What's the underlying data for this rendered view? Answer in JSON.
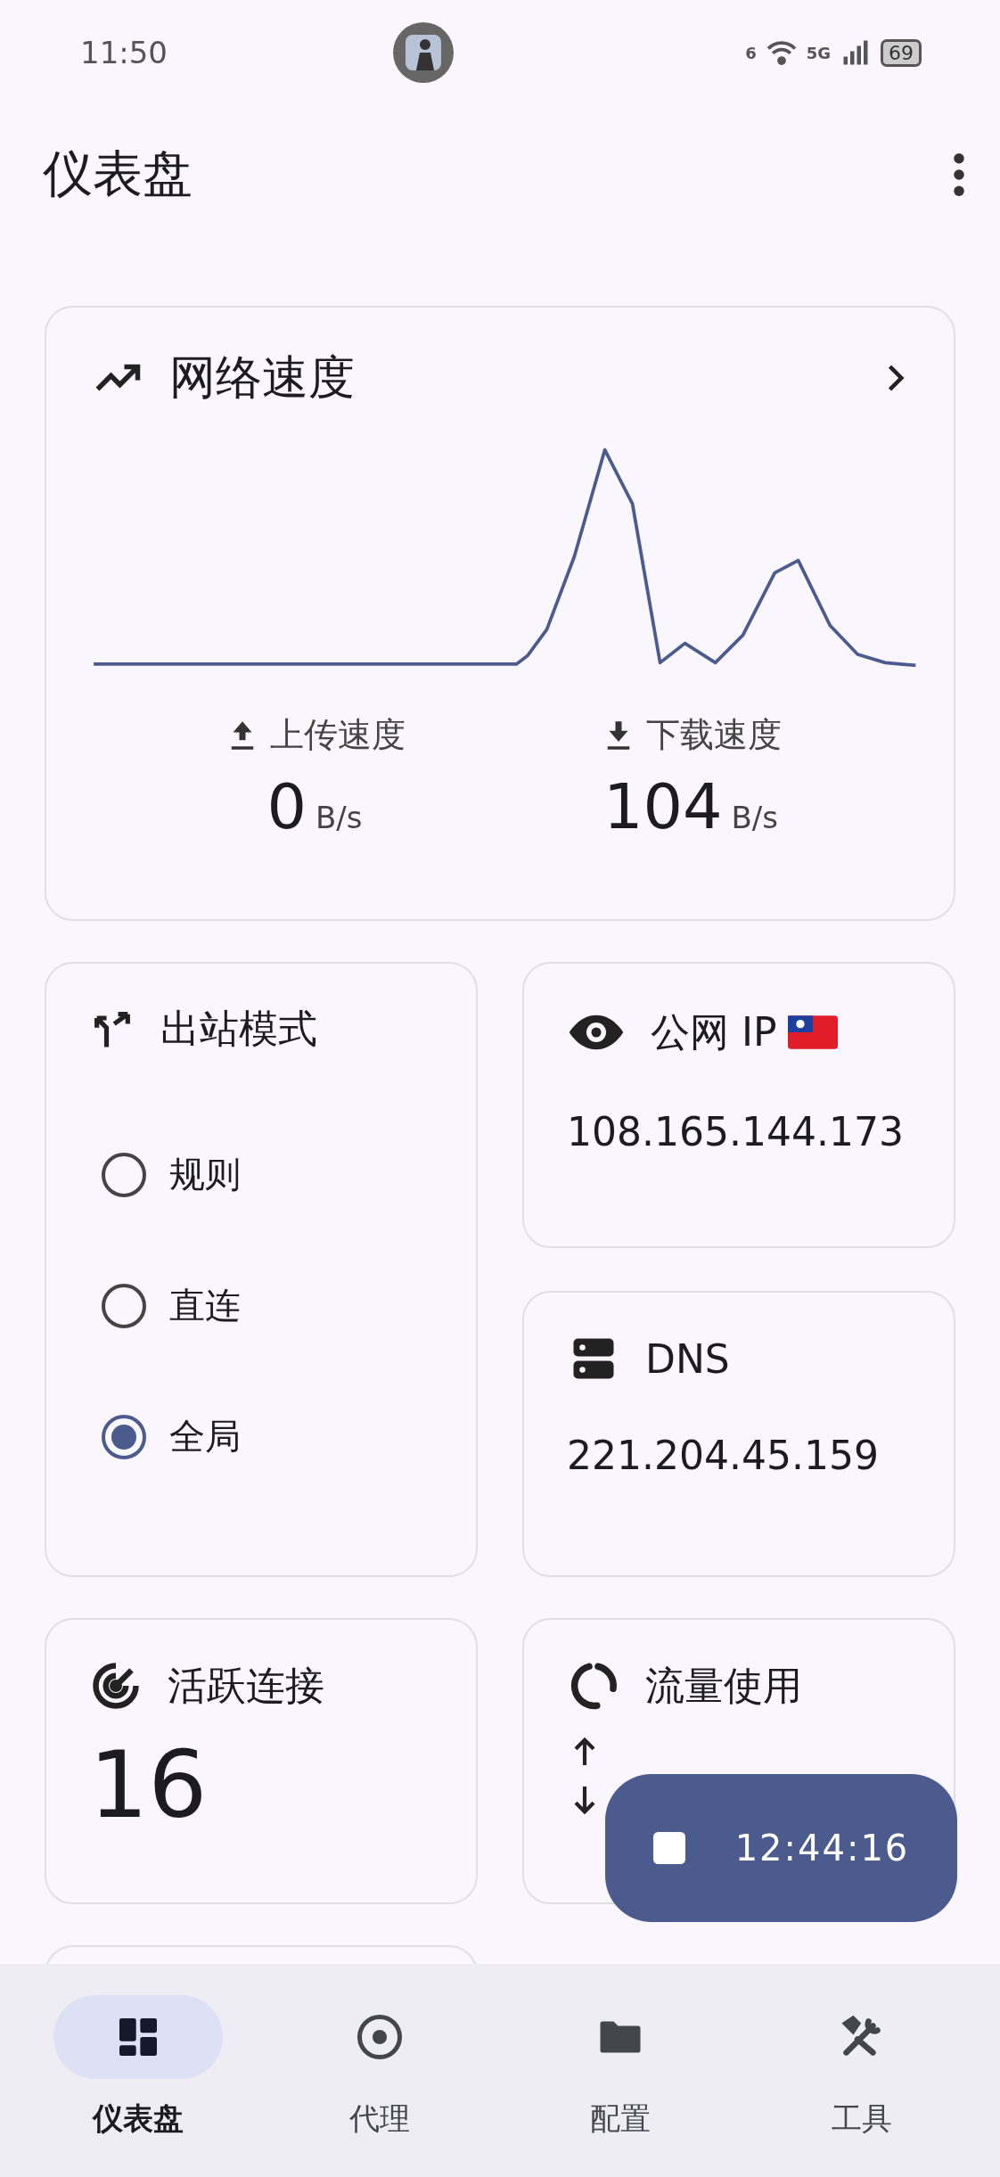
{
  "status_bar": {
    "time": "11:50",
    "wifi_label": "6",
    "network_label": "5G",
    "battery": "69"
  },
  "app_bar": {
    "title": "仪表盘"
  },
  "speed_card": {
    "title": "网络速度",
    "upload": {
      "label": "上传速度",
      "value": "0",
      "unit": "B/s"
    },
    "download": {
      "label": "下载速度",
      "value": "104",
      "unit": "B/s"
    }
  },
  "outbound_card": {
    "title": "出站模式",
    "options": [
      {
        "label": "规则",
        "selected": false
      },
      {
        "label": "直连",
        "selected": false
      },
      {
        "label": "全局",
        "selected": true
      }
    ]
  },
  "ip_card": {
    "title": "公网 IP",
    "value": "108.165.144.173"
  },
  "dns_card": {
    "title": "DNS",
    "value": "221.204.45.159"
  },
  "connections_card": {
    "title": "活跃连接",
    "value": "16"
  },
  "traffic_card": {
    "title": "流量使用"
  },
  "fab": {
    "label": "12:44:16"
  },
  "nav": [
    {
      "label": "仪表盘",
      "selected": true
    },
    {
      "label": "代理",
      "selected": false
    },
    {
      "label": "配置",
      "selected": false
    },
    {
      "label": "工具",
      "selected": false
    }
  ]
}
